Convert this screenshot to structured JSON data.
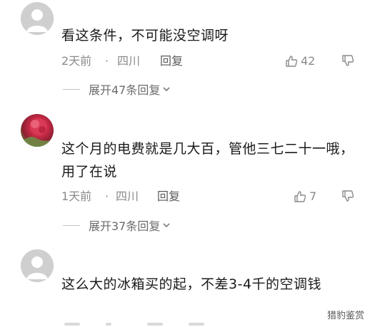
{
  "comments": [
    {
      "text": "看这条件，不可能没空调呀",
      "time": "2天前",
      "location": "四川",
      "reply_label": "回复",
      "likes": "42",
      "expand_label": "展开47条回复",
      "avatar": "default-avatar-icon"
    },
    {
      "text": "这个月的电费就是几大百，管他三七二十一哦，用了在说",
      "time": "1天前",
      "location": "四川",
      "reply_label": "回复",
      "likes": "7",
      "expand_label": "展开37条回复",
      "avatar": "flower-avatar"
    },
    {
      "text": "这么大的冰箱买的起，不差3-4千的空调钱",
      "avatar": "default-avatar-icon"
    }
  ],
  "separator": "·",
  "watermark": "猎豹鉴赏",
  "colors": {
    "text": "#1a1a1a",
    "meta": "#8a8a8a",
    "divider": "#c4c4c4"
  }
}
